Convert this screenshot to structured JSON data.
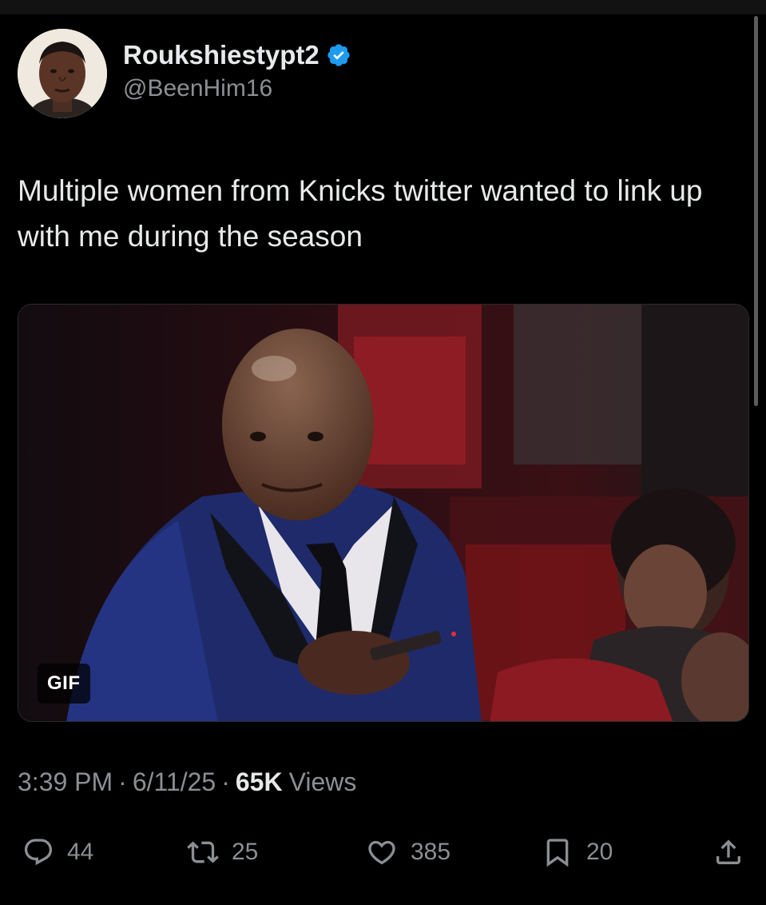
{
  "user": {
    "display_name": "Roukshiestypt2",
    "handle": "@BeenHim16",
    "verified": true,
    "verified_color": "#1d9bf0"
  },
  "tweet": {
    "text": "Multiple women from Knicks twitter wanted to link up with me during the season"
  },
  "media": {
    "badge": "GIF"
  },
  "meta": {
    "time": "3:39 PM",
    "separator": "·",
    "date": "6/11/25",
    "views_count": "65K",
    "views_label": "Views"
  },
  "actions": {
    "replies": "44",
    "reposts": "25",
    "likes": "385",
    "bookmarks": "20"
  },
  "icons": {
    "reply": "reply-bubble-icon",
    "repost": "repost-arrows-icon",
    "like": "heart-icon",
    "bookmark": "bookmark-icon",
    "share": "share-upload-icon"
  }
}
